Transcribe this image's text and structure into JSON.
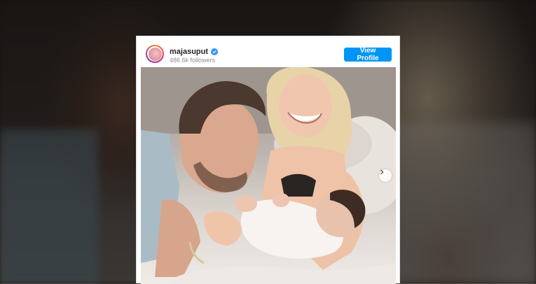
{
  "embed": {
    "username": "majasuput",
    "followers": "486.6k followers",
    "view_profile_label": "View Profile",
    "verified_icon": "verified-badge-icon",
    "next_icon": "chevron-right-icon"
  },
  "colors": {
    "button": "#0095f6",
    "verified": "#3897f0",
    "username": "#262626",
    "muted": "#8e8e8e"
  }
}
